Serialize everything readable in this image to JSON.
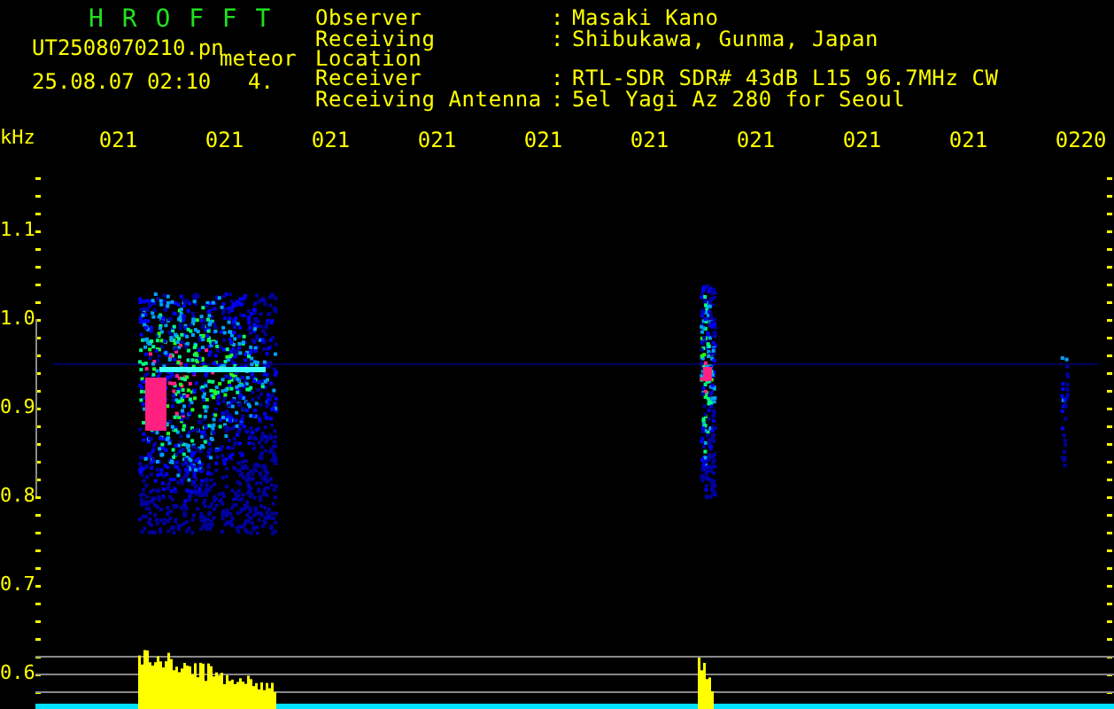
{
  "header": {
    "title": "H R O F F T",
    "filename": "UT2508070210.pn",
    "mode": "meteor",
    "datetime": "25.08.07 02:10",
    "count": "4.",
    "fields": [
      {
        "label": "Observer",
        "separator": ":",
        "value": "Masaki Kano"
      },
      {
        "label": "Receiving Location",
        "separator": ":",
        "value": "Shibukawa, Gunma, Japan"
      },
      {
        "label": "Receiver",
        "separator": ":",
        "value": "RTL-SDR SDR# 43dB L15 96.7MHz CW"
      },
      {
        "label": "Receiving Antenna",
        "separator": ":",
        "value": "5el Yagi Az 280 for Seoul"
      }
    ]
  },
  "y_axis": {
    "unit": "kHz",
    "labels": [
      "1.1",
      "1.0",
      "0.9",
      "0.8",
      "0.7",
      "0.6"
    ]
  },
  "time_labels": [
    "021",
    "021",
    "021",
    "021",
    "021",
    "021",
    "021",
    "021",
    "021",
    "0220"
  ]
}
